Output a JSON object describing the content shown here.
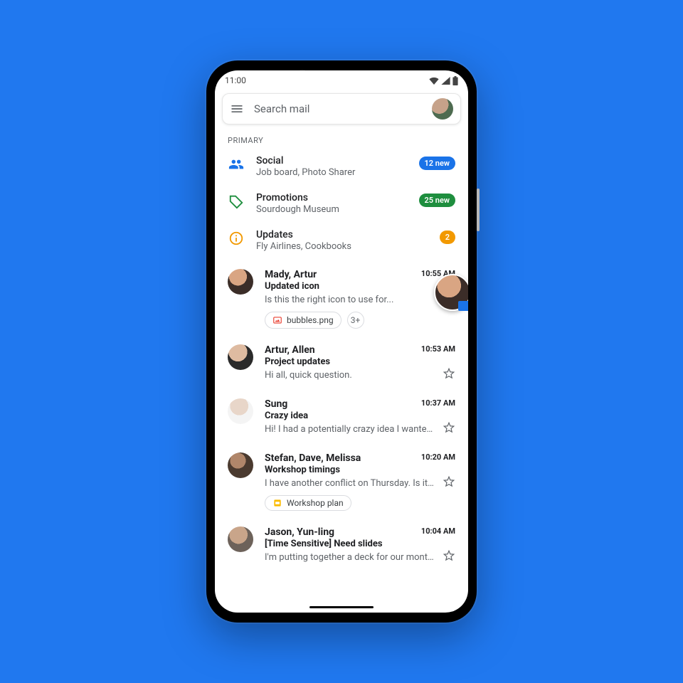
{
  "status": {
    "time": "11:00"
  },
  "search": {
    "placeholder": "Search mail"
  },
  "section": "PRIMARY",
  "categories": [
    {
      "title": "Social",
      "sub": "Job board, Photo Sharer",
      "badge": "12 new",
      "badgeColor": "blue",
      "icon": "social"
    },
    {
      "title": "Promotions",
      "sub": "Sourdough Museum",
      "badge": "25 new",
      "badgeColor": "green",
      "icon": "tag"
    },
    {
      "title": "Updates",
      "sub": "Fly Airlines, Cookbooks",
      "badge": "2",
      "badgeColor": "orange",
      "icon": "info"
    }
  ],
  "emails": [
    {
      "sender": "Mady, Artur",
      "subject": "Updated icon",
      "snippet": "Is this the right icon to use for...",
      "time": "10:55 AM",
      "chips": [
        {
          "label": "bubbles.png",
          "icon": "image"
        },
        {
          "label": "3+",
          "round": true
        }
      ]
    },
    {
      "sender": "Artur, Allen",
      "subject": "Project updates",
      "snippet": "Hi all, quick question.",
      "time": "10:53 AM"
    },
    {
      "sender": "Sung",
      "subject": "Crazy idea",
      "snippet": "Hi! I had a potentially crazy idea I wanted to...",
      "time": "10:37 AM"
    },
    {
      "sender": "Stefan, Dave, Melissa",
      "subject": "Workshop timings",
      "snippet": "I have another conflict on Thursday. Is it po...",
      "time": "10:20 AM",
      "chips": [
        {
          "label": "Workshop plan",
          "icon": "slides"
        }
      ]
    },
    {
      "sender": "Jason, Yun-ling",
      "subject": "[Time Sensitive] Need slides",
      "snippet": "I'm putting together a deck for our monthly...",
      "time": "10:04 AM"
    }
  ]
}
